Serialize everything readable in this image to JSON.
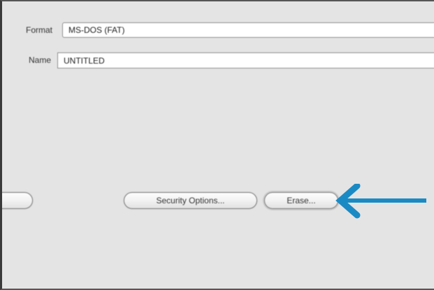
{
  "form": {
    "format_label": "Format",
    "format_value": "MS-DOS (FAT)",
    "name_label": "Name",
    "name_value": "UNTITLED"
  },
  "buttons": {
    "security_options_label": "Security Options...",
    "erase_label": "Erase..."
  },
  "annotation": {
    "arrow_color": "#1a8ac4",
    "arrow_direction": "left",
    "arrow_target": "erase-button"
  }
}
